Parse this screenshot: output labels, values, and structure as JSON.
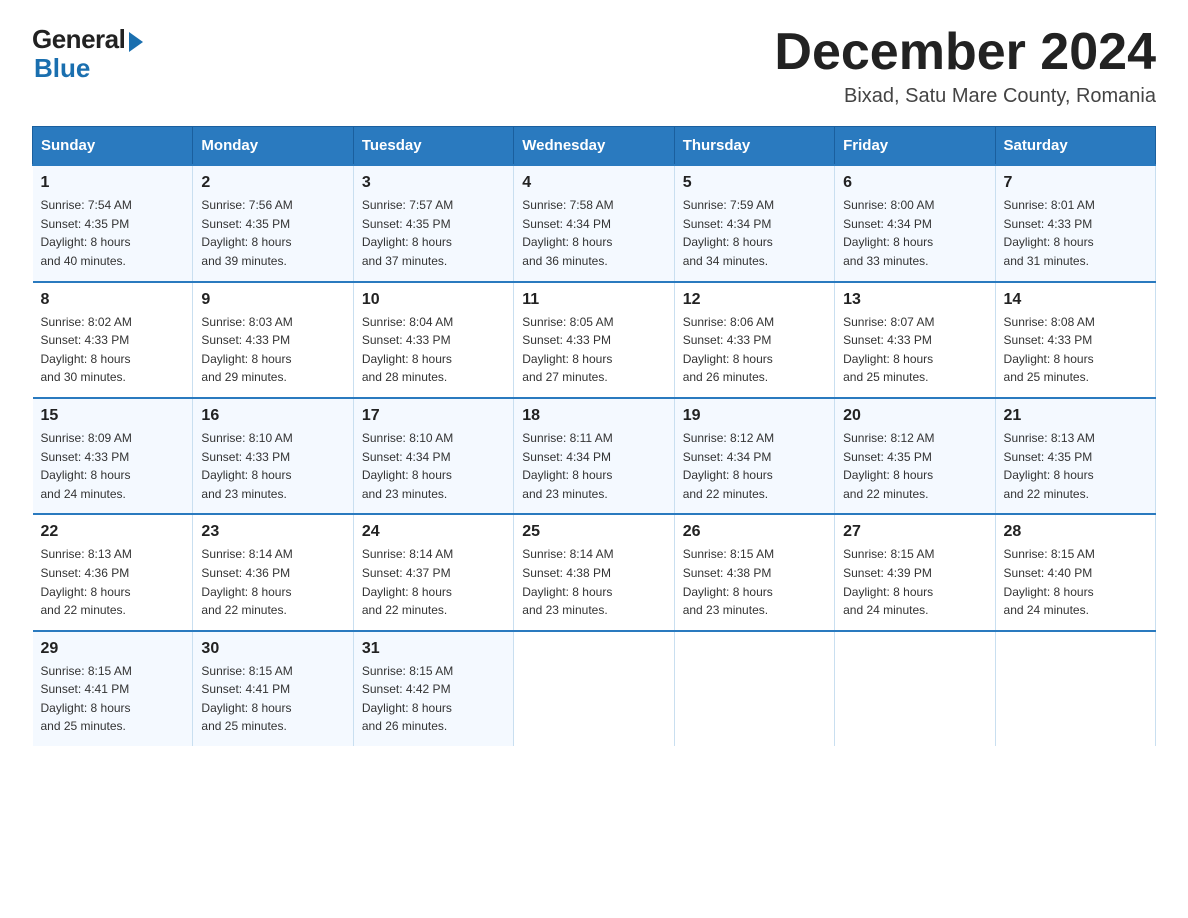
{
  "header": {
    "logo_general": "General",
    "logo_blue": "Blue",
    "month_title": "December 2024",
    "location": "Bixad, Satu Mare County, Romania"
  },
  "weekdays": [
    "Sunday",
    "Monday",
    "Tuesday",
    "Wednesday",
    "Thursday",
    "Friday",
    "Saturday"
  ],
  "weeks": [
    [
      {
        "day": "1",
        "sunrise": "7:54 AM",
        "sunset": "4:35 PM",
        "daylight": "8 hours and 40 minutes."
      },
      {
        "day": "2",
        "sunrise": "7:56 AM",
        "sunset": "4:35 PM",
        "daylight": "8 hours and 39 minutes."
      },
      {
        "day": "3",
        "sunrise": "7:57 AM",
        "sunset": "4:35 PM",
        "daylight": "8 hours and 37 minutes."
      },
      {
        "day": "4",
        "sunrise": "7:58 AM",
        "sunset": "4:34 PM",
        "daylight": "8 hours and 36 minutes."
      },
      {
        "day": "5",
        "sunrise": "7:59 AM",
        "sunset": "4:34 PM",
        "daylight": "8 hours and 34 minutes."
      },
      {
        "day": "6",
        "sunrise": "8:00 AM",
        "sunset": "4:34 PM",
        "daylight": "8 hours and 33 minutes."
      },
      {
        "day": "7",
        "sunrise": "8:01 AM",
        "sunset": "4:33 PM",
        "daylight": "8 hours and 31 minutes."
      }
    ],
    [
      {
        "day": "8",
        "sunrise": "8:02 AM",
        "sunset": "4:33 PM",
        "daylight": "8 hours and 30 minutes."
      },
      {
        "day": "9",
        "sunrise": "8:03 AM",
        "sunset": "4:33 PM",
        "daylight": "8 hours and 29 minutes."
      },
      {
        "day": "10",
        "sunrise": "8:04 AM",
        "sunset": "4:33 PM",
        "daylight": "8 hours and 28 minutes."
      },
      {
        "day": "11",
        "sunrise": "8:05 AM",
        "sunset": "4:33 PM",
        "daylight": "8 hours and 27 minutes."
      },
      {
        "day": "12",
        "sunrise": "8:06 AM",
        "sunset": "4:33 PM",
        "daylight": "8 hours and 26 minutes."
      },
      {
        "day": "13",
        "sunrise": "8:07 AM",
        "sunset": "4:33 PM",
        "daylight": "8 hours and 25 minutes."
      },
      {
        "day": "14",
        "sunrise": "8:08 AM",
        "sunset": "4:33 PM",
        "daylight": "8 hours and 25 minutes."
      }
    ],
    [
      {
        "day": "15",
        "sunrise": "8:09 AM",
        "sunset": "4:33 PM",
        "daylight": "8 hours and 24 minutes."
      },
      {
        "day": "16",
        "sunrise": "8:10 AM",
        "sunset": "4:33 PM",
        "daylight": "8 hours and 23 minutes."
      },
      {
        "day": "17",
        "sunrise": "8:10 AM",
        "sunset": "4:34 PM",
        "daylight": "8 hours and 23 minutes."
      },
      {
        "day": "18",
        "sunrise": "8:11 AM",
        "sunset": "4:34 PM",
        "daylight": "8 hours and 23 minutes."
      },
      {
        "day": "19",
        "sunrise": "8:12 AM",
        "sunset": "4:34 PM",
        "daylight": "8 hours and 22 minutes."
      },
      {
        "day": "20",
        "sunrise": "8:12 AM",
        "sunset": "4:35 PM",
        "daylight": "8 hours and 22 minutes."
      },
      {
        "day": "21",
        "sunrise": "8:13 AM",
        "sunset": "4:35 PM",
        "daylight": "8 hours and 22 minutes."
      }
    ],
    [
      {
        "day": "22",
        "sunrise": "8:13 AM",
        "sunset": "4:36 PM",
        "daylight": "8 hours and 22 minutes."
      },
      {
        "day": "23",
        "sunrise": "8:14 AM",
        "sunset": "4:36 PM",
        "daylight": "8 hours and 22 minutes."
      },
      {
        "day": "24",
        "sunrise": "8:14 AM",
        "sunset": "4:37 PM",
        "daylight": "8 hours and 22 minutes."
      },
      {
        "day": "25",
        "sunrise": "8:14 AM",
        "sunset": "4:38 PM",
        "daylight": "8 hours and 23 minutes."
      },
      {
        "day": "26",
        "sunrise": "8:15 AM",
        "sunset": "4:38 PM",
        "daylight": "8 hours and 23 minutes."
      },
      {
        "day": "27",
        "sunrise": "8:15 AM",
        "sunset": "4:39 PM",
        "daylight": "8 hours and 24 minutes."
      },
      {
        "day": "28",
        "sunrise": "8:15 AM",
        "sunset": "4:40 PM",
        "daylight": "8 hours and 24 minutes."
      }
    ],
    [
      {
        "day": "29",
        "sunrise": "8:15 AM",
        "sunset": "4:41 PM",
        "daylight": "8 hours and 25 minutes."
      },
      {
        "day": "30",
        "sunrise": "8:15 AM",
        "sunset": "4:41 PM",
        "daylight": "8 hours and 25 minutes."
      },
      {
        "day": "31",
        "sunrise": "8:15 AM",
        "sunset": "4:42 PM",
        "daylight": "8 hours and 26 minutes."
      },
      null,
      null,
      null,
      null
    ]
  ]
}
